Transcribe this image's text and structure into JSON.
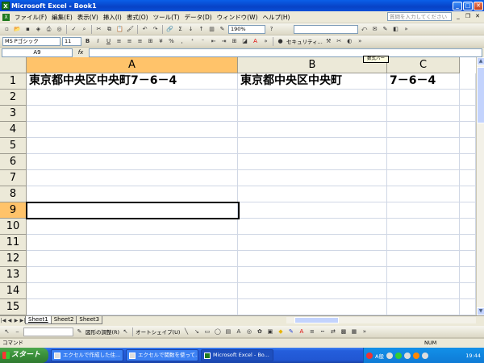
{
  "window": {
    "title": "Microsoft Excel - Book1"
  },
  "menu": {
    "items": [
      "ファイル(F)",
      "編集(E)",
      "表示(V)",
      "挿入(I)",
      "書式(O)",
      "ツール(T)",
      "データ(D)",
      "ウィンドウ(W)",
      "ヘルプ(H)"
    ],
    "help_placeholder": "質問を入力してください"
  },
  "toolbar": {
    "zoom": "190%",
    "font_name": "MS Pゴシック",
    "font_size": "11",
    "security_label": "セキュリティ..."
  },
  "formula_bar": {
    "name_box": "A9",
    "fx_label": "fx",
    "formula": "",
    "tooltip": "数式バー"
  },
  "sheet": {
    "columns": [
      "A",
      "B",
      "C"
    ],
    "selected_column": "A",
    "rows": [
      "1",
      "2",
      "3",
      "4",
      "5",
      "6",
      "7",
      "8",
      "9",
      "10",
      "11",
      "12",
      "13",
      "14",
      "15"
    ],
    "selected_row": "9",
    "cells": {
      "A1": "東京都中央区中央町7－6－4",
      "B1": "東京都中央区中央町",
      "C1": "7－6－4"
    },
    "active_cell": "A9"
  },
  "sheet_tabs": [
    "Sheet1",
    "Sheet2",
    "Sheet3"
  ],
  "active_sheet": "Sheet1",
  "drawing_toolbar": {
    "shape_menu": "図形の調整(R)",
    "autoshape_menu": "オートシェイプ(U)"
  },
  "status": {
    "mode": "コマンド",
    "num": "NUM"
  },
  "taskbar": {
    "start_label": "スタート",
    "items": [
      "エクセルで作成した住...",
      "エクセルで関数を使って...",
      "Microsoft Excel - Bo..."
    ],
    "active_index": 2,
    "ime": "A般",
    "clock": "19:44"
  }
}
